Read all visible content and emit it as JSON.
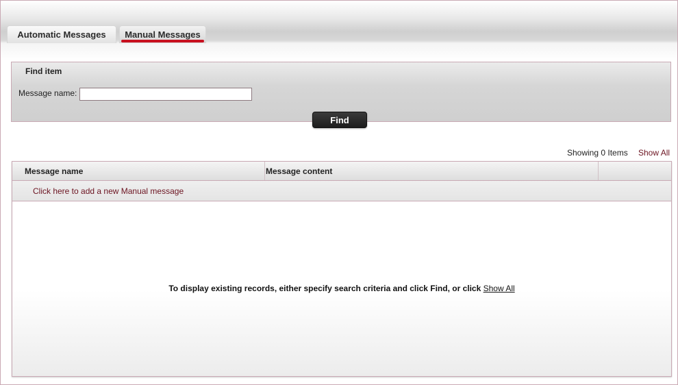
{
  "tabs": [
    {
      "label": "Automatic Messages",
      "active": false
    },
    {
      "label": "Manual Messages",
      "active": true
    }
  ],
  "find_panel": {
    "title": "Find item",
    "field_label": "Message name:",
    "field_value": "",
    "button_label": "Find"
  },
  "results": {
    "showing_text": "Showing 0 Items",
    "show_all_label": "Show All"
  },
  "grid": {
    "columns": [
      "Message name",
      "Message content"
    ],
    "add_link": "Click here to add a new Manual message",
    "empty_text": "To display existing records, either specify search criteria and click Find, or click",
    "empty_link": "Show All"
  },
  "colors": {
    "accent_underline": "#c8101f",
    "link": "#6b1320",
    "border": "#c9a9b4"
  }
}
